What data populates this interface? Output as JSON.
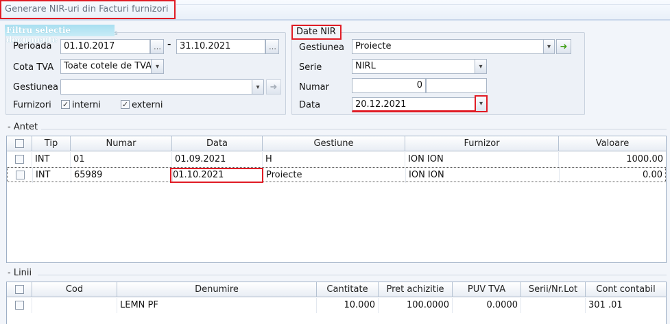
{
  "window": {
    "title": "Generare NIR-uri din Facturi furnizori"
  },
  "filtru": {
    "legend": "Filtru selectie documente",
    "perioada_label": "Perioada",
    "date_from": "01.10.2017",
    "separator": "-",
    "date_to": "31.10.2021",
    "cota_tva_label": "Cota TVA",
    "cota_tva_value": "Toate cotele de TVA",
    "gestiunea_label": "Gestiunea",
    "gestiunea_value": "",
    "furnizori_label": "Furnizori",
    "interni_label": "interni",
    "interni_checked": true,
    "externi_label": "externi",
    "externi_checked": true
  },
  "date_nir": {
    "legend": "Date NIR",
    "gestiunea_label": "Gestiunea",
    "gestiunea_value": "Proiecte",
    "serie_label": "Serie",
    "serie_value": "NIRL",
    "numar_label": "Numar",
    "numar_value": "0",
    "numar_extra": "",
    "data_label": "Data",
    "data_value": "20.12.2021"
  },
  "antet": {
    "section_label": "- Antet",
    "columns": [
      "Tip",
      "Numar",
      "Data",
      "Gestiune",
      "Furnizor",
      "Valoare"
    ],
    "rows": [
      {
        "tip": "INT",
        "numar": "01",
        "data": "01.09.2021",
        "gestiune": "H",
        "furnizor": "ION ION",
        "valoare": "1000.00"
      },
      {
        "tip": "INT",
        "numar": "65989",
        "data": "01.10.2021",
        "gestiune": "Proiecte",
        "furnizor": "ION ION",
        "valoare": "0.00"
      }
    ]
  },
  "linii": {
    "section_label": "- Linii",
    "columns": [
      "Cod",
      "Denumire",
      "Cantitate",
      "Pret achizitie",
      "PUV TVA",
      "Serii/Nr.Lot",
      "Cont contabil"
    ],
    "rows": [
      {
        "cod": "",
        "denumire": "LEMN PF",
        "cantitate": "10.000",
        "pret": "100.0000",
        "puv": "0.0000",
        "serii": "",
        "cont": "301 .01"
      }
    ]
  },
  "icons": {
    "ellipsis": "…",
    "dropdown": "▾",
    "go": "➜",
    "check": "✓"
  },
  "colors": {
    "highlight": "#e01b24",
    "go_arrow": "#43a017"
  }
}
